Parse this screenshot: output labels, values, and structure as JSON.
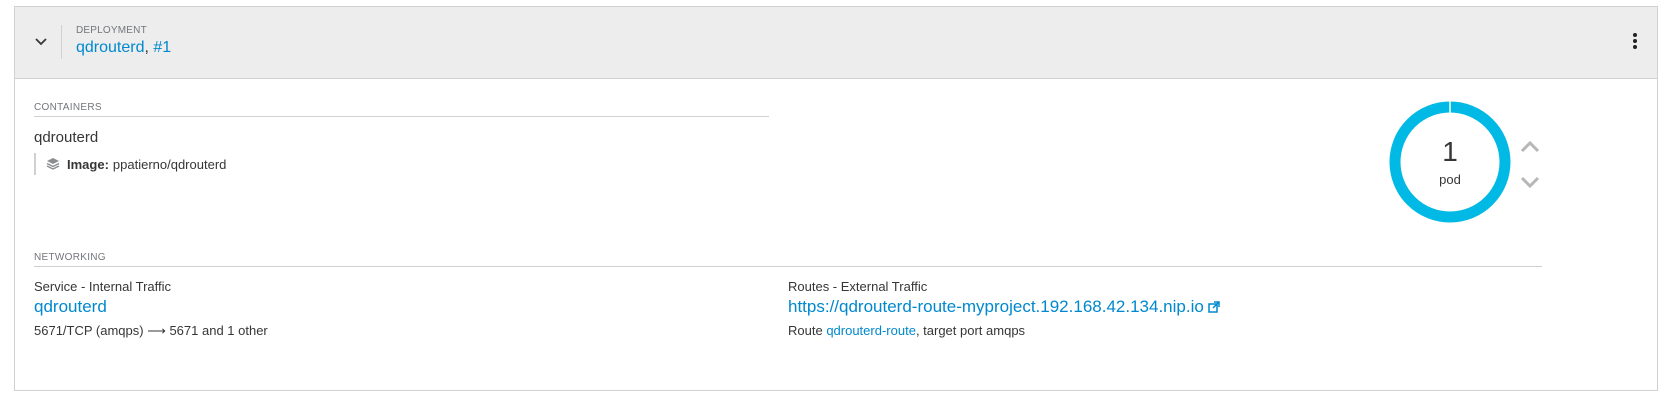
{
  "header": {
    "kind_label": "DEPLOYMENT",
    "name": "qdrouterd",
    "separator": ", ",
    "revision": "#1"
  },
  "containers": {
    "section_label": "CONTAINERS",
    "items": [
      {
        "name": "qdrouterd",
        "image_label": "Image:",
        "image_value": "ppatierno/qdrouterd"
      }
    ]
  },
  "pods": {
    "count": "1",
    "unit": "pod",
    "ring_color": "#00b9e4"
  },
  "networking": {
    "section_label": "NETWORKING",
    "service": {
      "title": "Service - Internal Traffic",
      "name": "qdrouterd",
      "ports": "5671/TCP (amqps) ⟶ 5671 and 1 other"
    },
    "routes": {
      "title": "Routes - External Traffic",
      "url": "https://qdrouterd-route-myproject.192.168.42.134.nip.io",
      "route_prefix": "Route ",
      "route_name": "qdrouterd-route",
      "route_suffix": ", target port amqps"
    }
  },
  "icons": {
    "toggle": "chevron-down-icon",
    "menu": "kebab-menu-icon",
    "image": "layers-icon",
    "scale_up": "chevron-up-icon",
    "scale_down": "chevron-down-icon",
    "external": "external-link-icon"
  },
  "colors": {
    "link": "#0088ce",
    "header_bg": "#ededed"
  }
}
